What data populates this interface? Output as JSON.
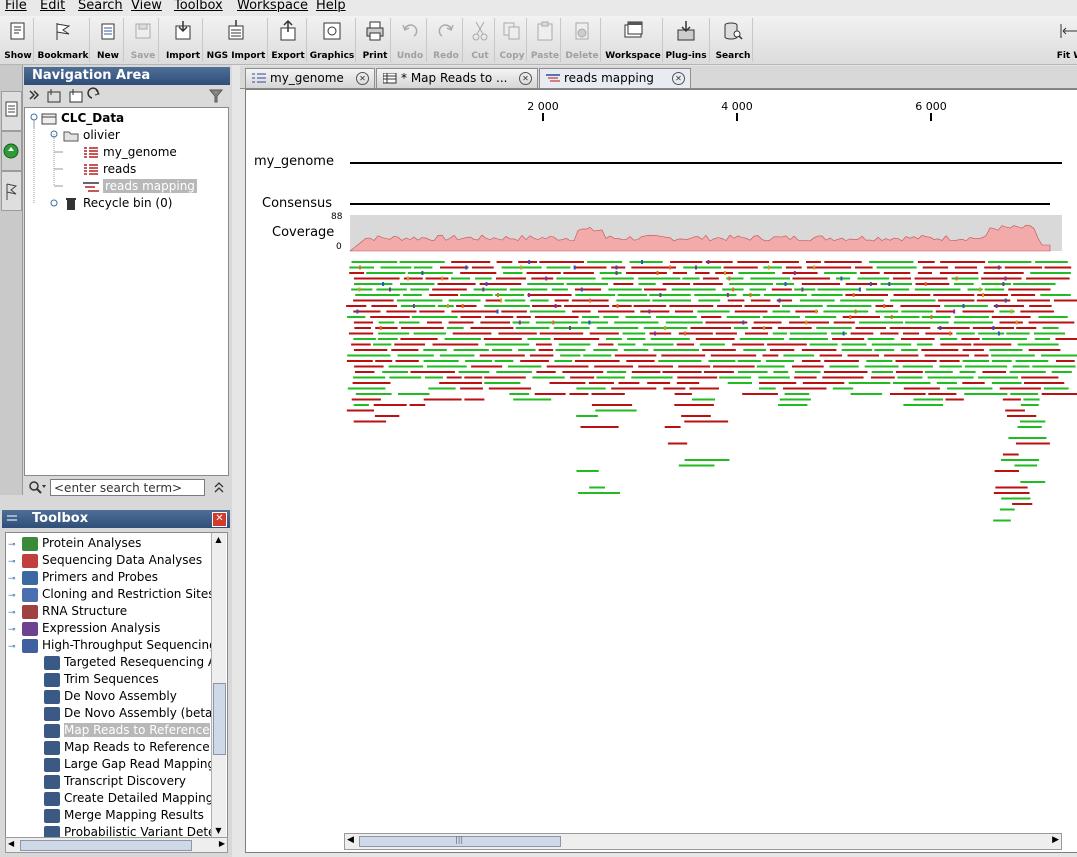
{
  "menu": [
    "File",
    "Edit",
    "Search",
    "View",
    "Toolbox",
    "Workspace",
    "Help"
  ],
  "toolbar": [
    {
      "label": "Show",
      "icon": "show-icon",
      "enabled": true
    },
    {
      "label": "Bookmark",
      "icon": "bookmark-flag-icon",
      "enabled": true
    },
    {
      "label": "New",
      "icon": "new-icon",
      "enabled": true
    },
    {
      "label": "Save",
      "icon": "save-icon",
      "enabled": false
    },
    {
      "label": "Import",
      "icon": "import-icon",
      "enabled": true
    },
    {
      "label": "NGS Import",
      "icon": "ngs-import-icon",
      "enabled": true
    },
    {
      "label": "Export",
      "icon": "export-icon",
      "enabled": true
    },
    {
      "label": "Graphics",
      "icon": "graphics-icon",
      "enabled": true
    },
    {
      "label": "Print",
      "icon": "printer-icon",
      "enabled": true
    },
    {
      "label": "Undo",
      "icon": "undo-icon",
      "enabled": false
    },
    {
      "label": "Redo",
      "icon": "redo-icon",
      "enabled": false
    },
    {
      "label": "Cut",
      "icon": "cut-icon",
      "enabled": false
    },
    {
      "label": "Copy",
      "icon": "copy-icon",
      "enabled": false
    },
    {
      "label": "Paste",
      "icon": "paste-icon",
      "enabled": false
    },
    {
      "label": "Delete",
      "icon": "delete-icon",
      "enabled": false
    },
    {
      "label": "Workspace",
      "icon": "workspace-icon",
      "enabled": true
    },
    {
      "label": "Plug-ins",
      "icon": "plugins-icon",
      "enabled": true
    },
    {
      "label": "Search",
      "icon": "search-database-icon",
      "enabled": true
    },
    {
      "label": "Fit W",
      "icon": "fit-width-icon",
      "enabled": true
    }
  ],
  "navigation": {
    "title": "Navigation Area",
    "tree": [
      {
        "label": "CLC_Data",
        "icon": "database-icon",
        "bold": true
      },
      {
        "label": "olivier",
        "icon": "folder-icon"
      },
      {
        "label": "my_genome",
        "icon": "sequence-icon"
      },
      {
        "label": "reads",
        "icon": "sequence-list-icon"
      },
      {
        "label": "reads mapping",
        "icon": "mapping-icon",
        "selected": true
      },
      {
        "label": "Recycle bin (0)",
        "icon": "trash-icon"
      }
    ],
    "search_placeholder": "<enter search term>"
  },
  "toolbox": {
    "title": "Toolbox",
    "items": [
      {
        "label": "Protein Analyses",
        "level": 0
      },
      {
        "label": "Sequencing Data Analyses",
        "level": 0
      },
      {
        "label": "Primers and Probes",
        "level": 0
      },
      {
        "label": "Cloning and Restriction Sites",
        "level": 0
      },
      {
        "label": "RNA Structure",
        "level": 0
      },
      {
        "label": "Expression Analysis",
        "level": 0
      },
      {
        "label": "High-Throughput Sequencing",
        "level": 0
      },
      {
        "label": "Targeted Resequencing A",
        "level": 1
      },
      {
        "label": "Trim Sequences",
        "level": 1
      },
      {
        "label": "De Novo Assembly",
        "level": 1
      },
      {
        "label": "De Novo Assembly (beta)",
        "level": 1
      },
      {
        "label": "Map Reads to Reference",
        "level": 1,
        "selected": true
      },
      {
        "label": "Map Reads to Reference",
        "level": 1
      },
      {
        "label": "Large Gap Read Mapping",
        "level": 1
      },
      {
        "label": "Transcript Discovery",
        "level": 1
      },
      {
        "label": "Create Detailed Mapping",
        "level": 1
      },
      {
        "label": "Merge Mapping Results",
        "level": 1
      },
      {
        "label": "Probabilistic Variant Dete",
        "level": 1
      }
    ]
  },
  "tabs": [
    {
      "label": "my_genome",
      "active": false
    },
    {
      "label": "* Map Reads to ...",
      "active": false
    },
    {
      "label": "reads mapping",
      "active": true
    }
  ],
  "viewer": {
    "ruler_ticks": [
      "2 000",
      "4 000",
      "6 000"
    ],
    "track_reference": "my_genome",
    "track_consensus": "Consensus",
    "track_coverage": "Coverage",
    "coverage_max": "88",
    "coverage_min": "0"
  },
  "colors": {
    "header_blue": "#3a5a85",
    "read_forward": "#22bb22",
    "read_reverse": "#bb1111",
    "coverage_fill": "#f2aaaa",
    "coverage_bg": "#d9d9d9",
    "selection": "#b8b8b8"
  }
}
